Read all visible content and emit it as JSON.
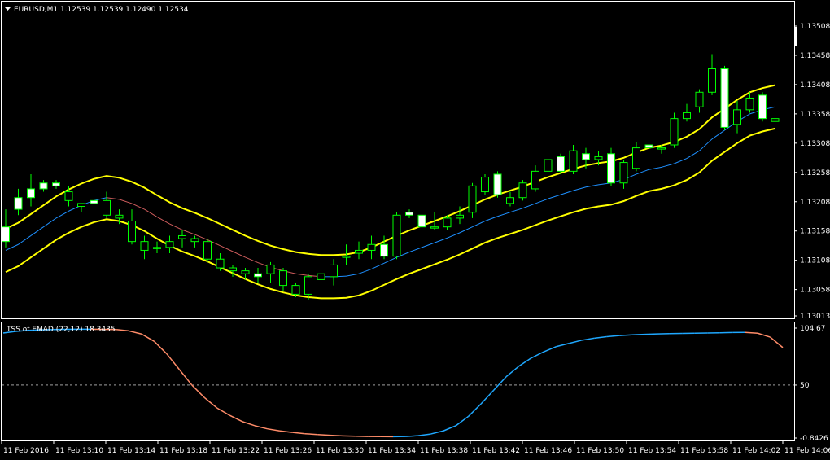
{
  "main_panel": {
    "symbol_header": "EURUSD,M1  1.12539 1.12539 1.12490 1.12534",
    "price_labels": [
      "1.13508",
      "1.13458",
      "1.13408",
      "1.13358",
      "1.13308",
      "1.13258",
      "1.13208",
      "1.13158",
      "1.13108",
      "1.13058",
      "1.13013"
    ]
  },
  "indicator_panel": {
    "header": "TSS of EMAD (22,12) 18.3435",
    "value_labels": [
      "104.67",
      "50",
      "-0.8426"
    ]
  },
  "time_labels": [
    "11 Feb 2016",
    "11 Feb 13:10",
    "11 Feb 13:14",
    "11 Feb 13:18",
    "11 Feb 13:22",
    "11 Feb 13:26",
    "11 Feb 13:30",
    "11 Feb 13:34",
    "11 Feb 13:38",
    "11 Feb 13:42",
    "11 Feb 13:46",
    "11 Feb 13:50",
    "11 Feb 13:54",
    "11 Feb 13:58",
    "11 Feb 14:02",
    "11 Feb 14:06"
  ],
  "colors": {
    "background": "#000000",
    "frame": "#ffffff",
    "bull_body": "#000000",
    "bear_body": "#ffffff",
    "wick": "#00ff00",
    "envelope": "#ffff00",
    "ema_middle_up": "#1e90ff",
    "ema_middle_down": "#cd5c5c",
    "tss_up": "#1fa8ff",
    "tss_down": "#ff8c69"
  },
  "chart_data": [
    {
      "type": "candlestick",
      "title": "EURUSD,M1",
      "ohlc_last": {
        "open": 1.12539,
        "high": 1.12539,
        "low": 1.1249,
        "close": 1.12534
      },
      "ylim": [
        1.13013,
        1.13508
      ],
      "candles": [
        [
          1.13165,
          1.13195,
          1.1313,
          1.1314
        ],
        [
          1.13215,
          1.1323,
          1.13185,
          1.13195
        ],
        [
          1.1323,
          1.13255,
          1.132,
          1.13215
        ],
        [
          1.1324,
          1.13245,
          1.13225,
          1.1323
        ],
        [
          1.1324,
          1.13245,
          1.1323,
          1.13235
        ],
        [
          1.1321,
          1.13235,
          1.132,
          1.13225
        ],
        [
          1.132,
          1.13205,
          1.1319,
          1.13205
        ],
        [
          1.1321,
          1.13215,
          1.132,
          1.13205
        ],
        [
          1.13185,
          1.13225,
          1.1318,
          1.1321
        ],
        [
          1.1318,
          1.13195,
          1.1317,
          1.13185
        ],
        [
          1.1314,
          1.13195,
          1.13135,
          1.13175
        ],
        [
          1.13125,
          1.1315,
          1.1311,
          1.1314
        ],
        [
          1.1313,
          1.1314,
          1.1312,
          1.1313
        ],
        [
          1.1313,
          1.1315,
          1.1312,
          1.1314
        ],
        [
          1.13145,
          1.1316,
          1.1313,
          1.1315
        ],
        [
          1.1314,
          1.1315,
          1.1313,
          1.13145
        ],
        [
          1.1311,
          1.13145,
          1.13105,
          1.1314
        ],
        [
          1.13095,
          1.1312,
          1.1309,
          1.1311
        ],
        [
          1.1309,
          1.131,
          1.1308,
          1.13095
        ],
        [
          1.13085,
          1.13095,
          1.13075,
          1.1309
        ],
        [
          1.13085,
          1.13095,
          1.1307,
          1.1308
        ],
        [
          1.13085,
          1.13105,
          1.1307,
          1.131
        ],
        [
          1.13065,
          1.13095,
          1.13055,
          1.1309
        ],
        [
          1.1305,
          1.1307,
          1.13045,
          1.13065
        ],
        [
          1.1305,
          1.13085,
          1.1304,
          1.1308
        ],
        [
          1.13075,
          1.13085,
          1.13065,
          1.13085
        ],
        [
          1.1308,
          1.1311,
          1.13065,
          1.131
        ],
        [
          1.13115,
          1.13135,
          1.131,
          1.13115
        ],
        [
          1.1312,
          1.1314,
          1.1311,
          1.13125
        ],
        [
          1.13125,
          1.1315,
          1.1311,
          1.13135
        ],
        [
          1.13135,
          1.1315,
          1.1311,
          1.13115
        ],
        [
          1.13115,
          1.1319,
          1.1311,
          1.13185
        ],
        [
          1.1319,
          1.13195,
          1.1318,
          1.13185
        ],
        [
          1.13185,
          1.1319,
          1.13155,
          1.13165
        ],
        [
          1.13165,
          1.1319,
          1.1316,
          1.13165
        ],
        [
          1.13165,
          1.13185,
          1.1316,
          1.1318
        ],
        [
          1.1318,
          1.132,
          1.1317,
          1.13185
        ],
        [
          1.1319,
          1.1324,
          1.1318,
          1.13235
        ],
        [
          1.13225,
          1.13255,
          1.1322,
          1.1325
        ],
        [
          1.13255,
          1.1326,
          1.13215,
          1.1322
        ],
        [
          1.13205,
          1.13225,
          1.132,
          1.13215
        ],
        [
          1.13215,
          1.13245,
          1.1321,
          1.1324
        ],
        [
          1.1323,
          1.1327,
          1.13225,
          1.1326
        ],
        [
          1.1326,
          1.1329,
          1.1325,
          1.1328
        ],
        [
          1.13285,
          1.1329,
          1.13255,
          1.1326
        ],
        [
          1.1326,
          1.13305,
          1.13255,
          1.13295
        ],
        [
          1.1329,
          1.133,
          1.13265,
          1.1328
        ],
        [
          1.1328,
          1.13295,
          1.1327,
          1.13285
        ],
        [
          1.1329,
          1.133,
          1.13235,
          1.1324
        ],
        [
          1.1324,
          1.1328,
          1.1323,
          1.13275
        ],
        [
          1.13265,
          1.1331,
          1.1326,
          1.133
        ],
        [
          1.13305,
          1.1331,
          1.1329,
          1.133
        ],
        [
          1.133,
          1.13305,
          1.1329,
          1.133
        ],
        [
          1.13305,
          1.1336,
          1.133,
          1.1335
        ],
        [
          1.1335,
          1.13375,
          1.13345,
          1.1336
        ],
        [
          1.1337,
          1.134,
          1.1336,
          1.13395
        ],
        [
          1.13395,
          1.1346,
          1.1339,
          1.13435
        ],
        [
          1.13435,
          1.1344,
          1.1333,
          1.13335
        ],
        [
          1.1334,
          1.1338,
          1.13325,
          1.13365
        ],
        [
          1.13365,
          1.13395,
          1.1336,
          1.13385
        ],
        [
          1.1339,
          1.13395,
          1.13345,
          1.1335
        ],
        [
          1.13345,
          1.1336,
          1.13335,
          1.1335
        ]
      ],
      "ema": [
        1.13125,
        1.13135,
        1.1315,
        1.13165,
        1.1318,
        1.13192,
        1.13202,
        1.1321,
        1.13215,
        1.13212,
        1.13205,
        1.13195,
        1.13182,
        1.1317,
        1.1316,
        1.13152,
        1.13143,
        1.13133,
        1.13123,
        1.13113,
        1.13104,
        1.13096,
        1.1309,
        1.13085,
        1.13082,
        1.1308,
        1.1308,
        1.13081,
        1.13085,
        1.13093,
        1.13103,
        1.13113,
        1.13122,
        1.1313,
        1.13138,
        1.13146,
        1.13155,
        1.13165,
        1.13175,
        1.13183,
        1.1319,
        1.13197,
        1.13205,
        1.13213,
        1.1322,
        1.13227,
        1.13233,
        1.13237,
        1.1324,
        1.13246,
        1.13255,
        1.13263,
        1.13267,
        1.13273,
        1.13282,
        1.13295,
        1.13315,
        1.1333,
        1.13345,
        1.13358,
        1.13365,
        1.1337
      ],
      "upper_envelope": [
        1.13162,
        1.13172,
        1.13187,
        1.13202,
        1.13217,
        1.13229,
        1.13239,
        1.13247,
        1.13252,
        1.13249,
        1.13242,
        1.13232,
        1.13219,
        1.13207,
        1.13197,
        1.13189,
        1.1318,
        1.1317,
        1.1316,
        1.1315,
        1.13141,
        1.13133,
        1.13127,
        1.13122,
        1.13119,
        1.13117,
        1.13117,
        1.13118,
        1.13122,
        1.1313,
        1.1314,
        1.1315,
        1.13159,
        1.13167,
        1.13175,
        1.13183,
        1.13192,
        1.13202,
        1.13212,
        1.1322,
        1.13227,
        1.13234,
        1.13242,
        1.1325,
        1.13257,
        1.13264,
        1.1327,
        1.13274,
        1.13277,
        1.13283,
        1.13292,
        1.133,
        1.13304,
        1.1331,
        1.13319,
        1.13332,
        1.13352,
        1.13367,
        1.13382,
        1.13395,
        1.13402,
        1.13407
      ],
      "lower_envelope": [
        1.13088,
        1.13098,
        1.13113,
        1.13128,
        1.13143,
        1.13155,
        1.13165,
        1.13173,
        1.13178,
        1.13175,
        1.13168,
        1.13158,
        1.13145,
        1.13133,
        1.13123,
        1.13115,
        1.13106,
        1.13096,
        1.13086,
        1.13076,
        1.13067,
        1.13059,
        1.13053,
        1.13048,
        1.13045,
        1.13043,
        1.13043,
        1.13044,
        1.13048,
        1.13056,
        1.13066,
        1.13076,
        1.13085,
        1.13093,
        1.13101,
        1.13109,
        1.13118,
        1.13128,
        1.13138,
        1.13146,
        1.13153,
        1.1316,
        1.13168,
        1.13176,
        1.13183,
        1.1319,
        1.13196,
        1.132,
        1.13203,
        1.13209,
        1.13218,
        1.13226,
        1.1323,
        1.13236,
        1.13245,
        1.13258,
        1.13278,
        1.13293,
        1.13308,
        1.13321,
        1.13328,
        1.13333
      ]
    },
    {
      "type": "line",
      "title": "TSS of EMAD (22,12) 18.3435",
      "ylim": [
        -0.8426,
        104.67
      ],
      "values": [
        100,
        101.5,
        102.5,
        103,
        103.3,
        103.5,
        103.6,
        103.6,
        103.5,
        103.3,
        102,
        99,
        92,
        80,
        65,
        50,
        38,
        28,
        21,
        15,
        11,
        8,
        6,
        4.5,
        3.3,
        2.5,
        1.8,
        1.2,
        0.9,
        0.6,
        0.5,
        0.4,
        0.6,
        1.4,
        3,
        6,
        11,
        20,
        32,
        45,
        58,
        68,
        76,
        82,
        87,
        90,
        93,
        95,
        96.5,
        97.5,
        98.2,
        98.7,
        99.1,
        99.4,
        99.6,
        99.8,
        100,
        100.2,
        100.5,
        100.6,
        99.8,
        96,
        86
      ],
      "levels": [
        50
      ],
      "grid": false
    }
  ]
}
